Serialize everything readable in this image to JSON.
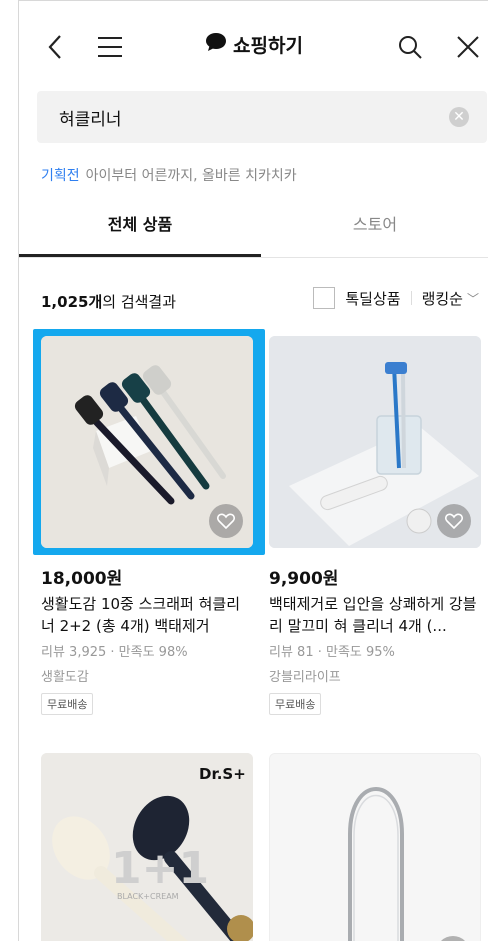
{
  "header": {
    "title": "쇼핑하기",
    "back_icon": "back-arrow-icon",
    "menu_icon": "menu-icon",
    "search_icon": "search-icon",
    "close_icon": "close-icon"
  },
  "search": {
    "value": "혀클리너"
  },
  "promo": {
    "tag": "기획전",
    "text": "아이부터 어른까지, 올바른 치카치카"
  },
  "tabs": [
    {
      "label": "전체 상품"
    },
    {
      "label": "스토어"
    }
  ],
  "results": {
    "count": "1,025개",
    "suffix": "의 검색결과",
    "filter_label": "톡딜상품",
    "sort_label": "랭킹순"
  },
  "products": [
    {
      "price": "18,000원",
      "name": "생활도감 10중 스크래퍼 혀클리너 2+2 (총 4개) 백태제거",
      "meta": "리뷰 3,925 · 만족도 98%",
      "seller": "생활도감",
      "badge": "무료배송"
    },
    {
      "price": "9,900원",
      "name": "백태제거로 입안을 상쾌하게 강블리 말끄미 혀 클리너 4개 (...",
      "meta": "리뷰 81 · 만족도 95%",
      "seller": "강블리라이프",
      "badge": "무료배송"
    },
    {
      "brand_text": "Dr.S+",
      "overlay_text": "1+1",
      "overlay_sub": "BLACK+CREAM"
    },
    {}
  ],
  "colors": {
    "accent": "#2f7ff0",
    "selection": "#14a8ee"
  }
}
